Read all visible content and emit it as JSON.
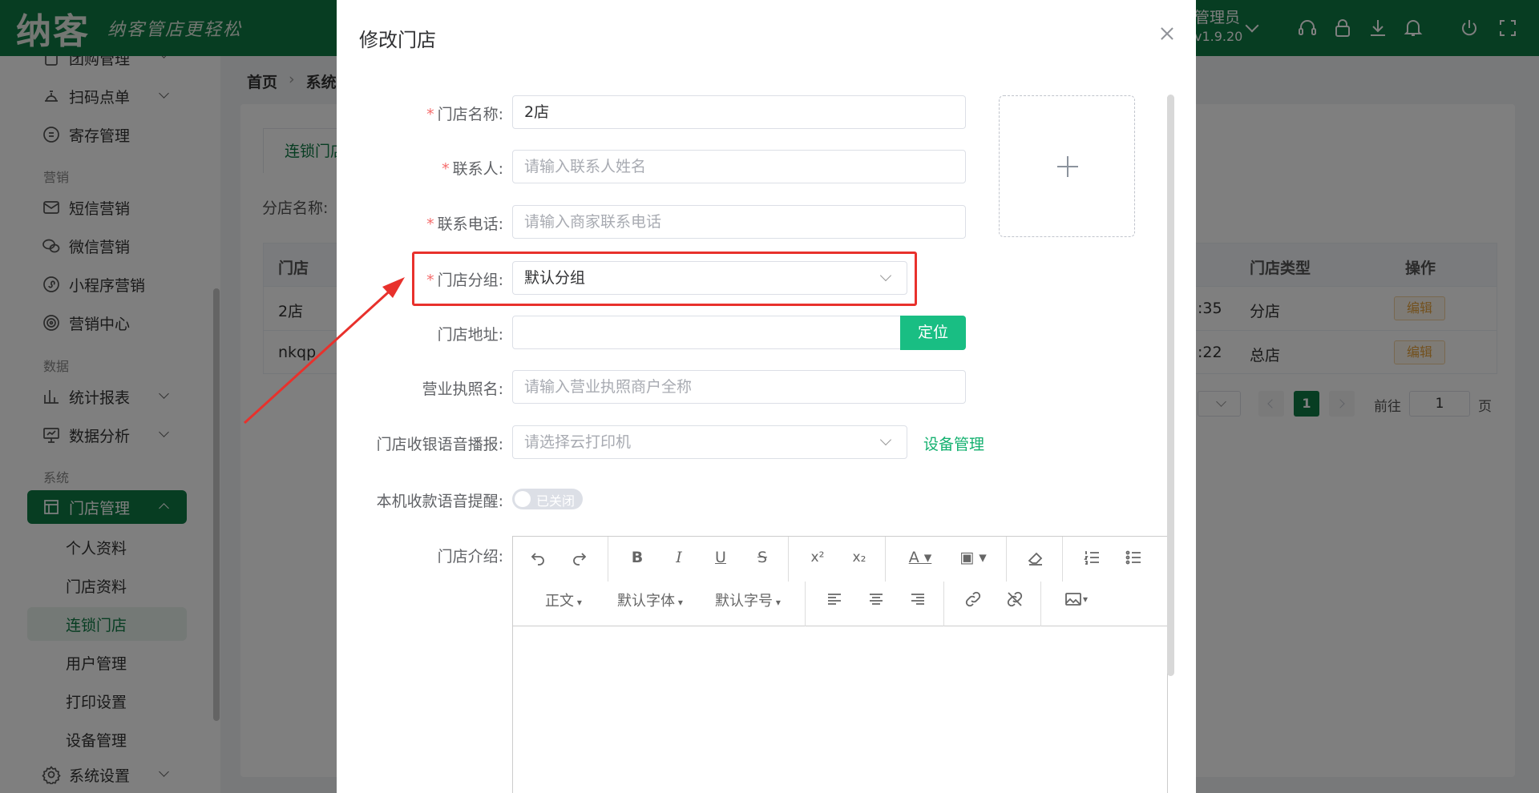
{
  "topbar": {
    "logo": "纳客",
    "slogan": "纳客管店更轻松",
    "user": "管理员",
    "version": "v1.9.20",
    "icons": [
      "headset-icon",
      "lock-icon",
      "download-icon",
      "bell-icon",
      "power-icon",
      "fullscreen-icon"
    ]
  },
  "sidebar": {
    "items": [
      {
        "label": "团购管理"
      },
      {
        "label": "扫码点单"
      },
      {
        "label": "寄存管理"
      }
    ],
    "section_marketing": "营销",
    "marketing": [
      {
        "label": "短信营销"
      },
      {
        "label": "微信营销"
      },
      {
        "label": "小程序营销"
      },
      {
        "label": "营销中心"
      }
    ],
    "section_data": "数据",
    "data_items": [
      {
        "label": "统计报表"
      },
      {
        "label": "数据分析"
      }
    ],
    "section_system": "系统",
    "store_mgmt": "门店管理",
    "sub_items": [
      {
        "label": "个人资料"
      },
      {
        "label": "门店资料"
      },
      {
        "label": "连锁门店"
      },
      {
        "label": "用户管理"
      },
      {
        "label": "打印设置"
      },
      {
        "label": "设备管理"
      }
    ],
    "system_settings": "系统设置"
  },
  "page": {
    "breadcrumb": [
      "首页",
      "系统"
    ],
    "tab": "连锁门店",
    "branch_label": "分店名称:",
    "table": {
      "headers": {
        "store": "门店",
        "type": "门店类型",
        "action": "操作"
      },
      "rows": [
        {
          "store": "2店",
          "time_tail": ":35",
          "type": "分店",
          "action": "编辑"
        },
        {
          "store": "nkqp",
          "time_tail": ":22",
          "type": "总店",
          "action": "编辑"
        }
      ]
    },
    "pager": {
      "current": "1",
      "goto_label": "前往",
      "goto_value": "1",
      "page_suffix": "页"
    }
  },
  "dialog": {
    "title": "修改门店",
    "fields": {
      "name": {
        "label": "门店名称:",
        "value": "2店"
      },
      "contact": {
        "label": "联系人:",
        "placeholder": "请输入联系人姓名"
      },
      "phone": {
        "label": "联系电话:",
        "placeholder": "请输入商家联系电话"
      },
      "group": {
        "label": "门店分组:",
        "value": "默认分组"
      },
      "address": {
        "label": "门店地址:",
        "button": "定位"
      },
      "license": {
        "label": "营业执照名:",
        "placeholder": "请输入营业执照商户全称"
      },
      "voice": {
        "label": "门店收银语音播报:",
        "placeholder": "请选择云打印机",
        "link": "设备管理"
      },
      "local_voice": {
        "label": "本机收款语音提醒:",
        "toggle_text": "已关闭"
      },
      "intro": {
        "label": "门店介绍:"
      }
    },
    "editor": {
      "paragraph": "正文",
      "font": "默认字体",
      "size": "默认字号"
    }
  },
  "colors": {
    "brand": "#0e7a45",
    "accent": "#19be83",
    "highlight": "#e8312c"
  }
}
